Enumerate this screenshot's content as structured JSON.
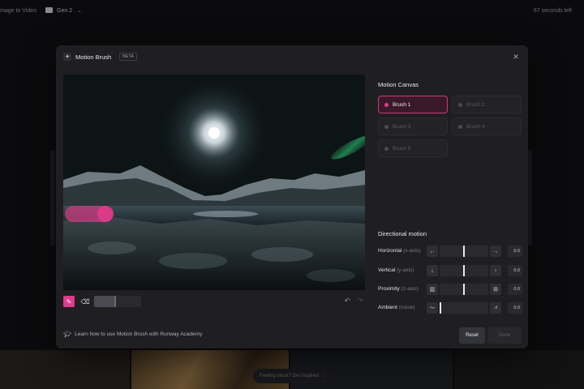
{
  "topbar": {
    "crumb_tool": "mage to Video",
    "crumb_folder": "Gen 2",
    "time_left": "67 seconds left"
  },
  "footer": {
    "feeling_stuck": "Feeling stuck? Get inspired"
  },
  "modal": {
    "title": "Motion Brush",
    "badge": "BETA",
    "close_glyph": "✕"
  },
  "tools": {
    "brush_glyph": "✎",
    "eraser_glyph": "⌫",
    "brush_size_fraction": 0.45,
    "undo_glyph": "↶",
    "redo_glyph": "↷"
  },
  "motion_canvas": {
    "title": "Motion Canvas",
    "brushes": [
      {
        "label": "Brush 1",
        "active": true
      },
      {
        "label": "Brush 2",
        "active": false
      },
      {
        "label": "Brush 3",
        "active": false
      },
      {
        "label": "Brush 4",
        "active": false
      },
      {
        "label": "Brush 5",
        "active": false
      }
    ]
  },
  "directional_motion": {
    "title": "Directional motion",
    "rows": [
      {
        "label": "Horizontal",
        "sub": "(x-axis)",
        "left_icon": "←",
        "right_icon": "→",
        "value": "0.0",
        "position": 0.5
      },
      {
        "label": "Vertical",
        "sub": "(y-axis)",
        "left_icon": "↓",
        "right_icon": "↑",
        "value": "0.0",
        "position": 0.5
      },
      {
        "label": "Proximity",
        "sub": "(z-axis)",
        "left_icon": "▥",
        "right_icon": "⊞",
        "value": "0.0",
        "position": 0.5
      },
      {
        "label": "Ambient",
        "sub": "(noise)",
        "left_icon": "〜",
        "right_icon": "⩘",
        "value": "0.0",
        "position": 0.0
      }
    ]
  },
  "footer_bar": {
    "academy_link": "Learn how to use Motion Brush with Runway Academy",
    "reset_label": "Reset",
    "done_label": "Done"
  },
  "colors": {
    "accent": "#e23a8c",
    "panel": "#1f1f22"
  }
}
